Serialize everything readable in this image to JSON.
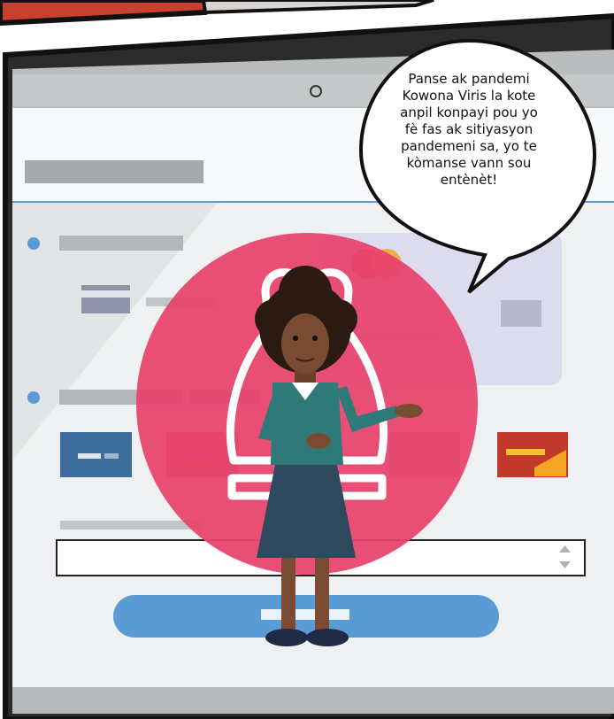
{
  "speech_bubble": {
    "lines": [
      "Panse ak pandemi",
      "Kowona Viris la kote",
      "anpil konpayi pou yo",
      "fè fas ak sitiyasyon",
      "pandemeni sa, yo te",
      "kòmanse vann sou",
      "entènèt!"
    ]
  },
  "colors": {
    "comic_border": "#111111",
    "monitor_frame": "#b9bdbe",
    "screen_bg": "#eef0f1",
    "accent_blue": "#5a9bd6",
    "pink_circle": "#e8456e",
    "skin": "#7a4b33",
    "sweater": "#2f7a78",
    "skirt": "#2f4a5e",
    "hair": "#2b1a12"
  },
  "icons": [
    "webcam-icon",
    "spinner-up-icon",
    "spinner-down-icon",
    "shopping-bag-icon",
    "card-logo-icon"
  ]
}
